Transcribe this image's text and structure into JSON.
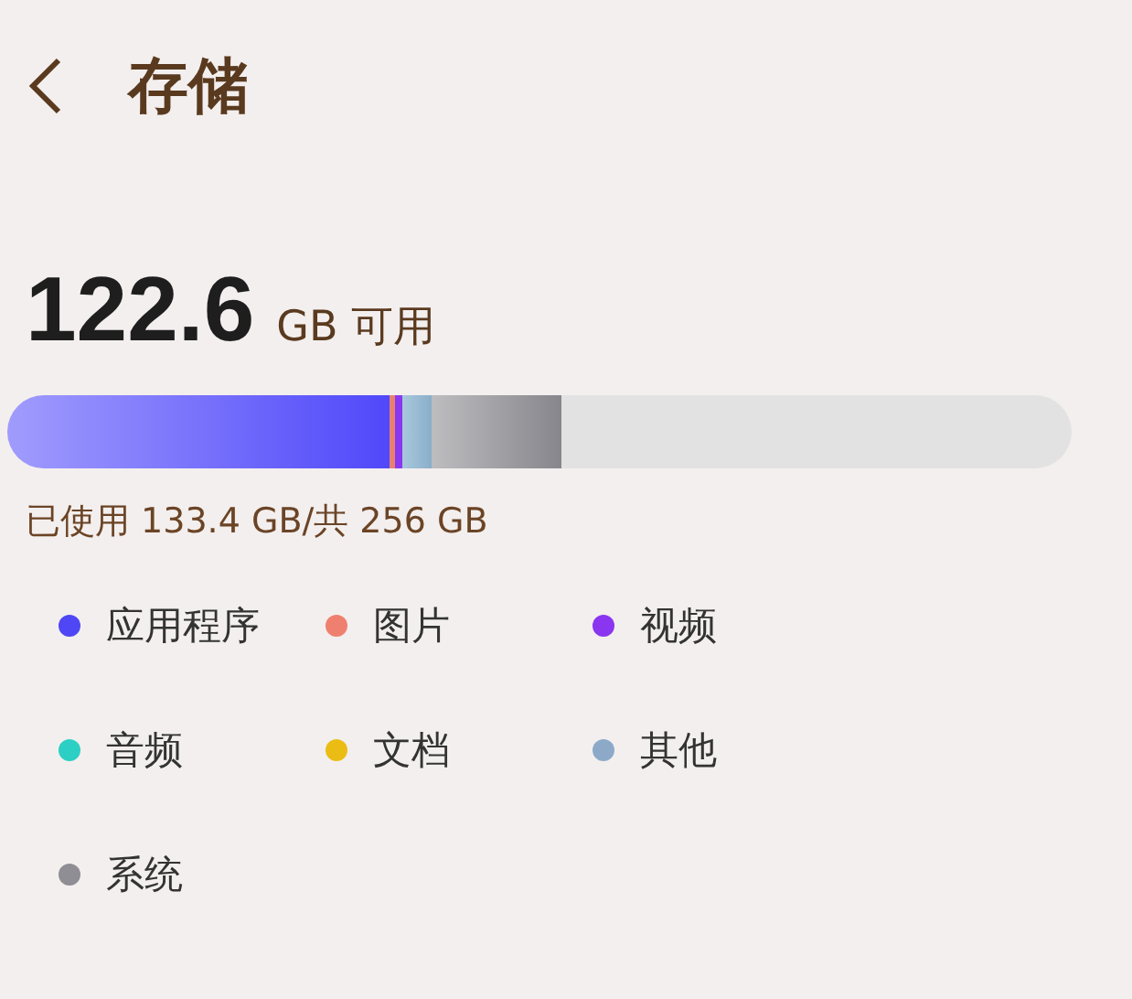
{
  "header": {
    "title": "存储"
  },
  "summary": {
    "amount": "122.6",
    "unit": "GB 可用"
  },
  "used_text": "已使用 133.4 GB/共 256 GB",
  "legend": [
    {
      "label": "应用程序",
      "color": "#4f47f5"
    },
    {
      "label": "图片",
      "color": "#ef8070"
    },
    {
      "label": "视频",
      "color": "#8a35ef"
    },
    {
      "label": "音频",
      "color": "#2ccfc4"
    },
    {
      "label": "文档",
      "color": "#ebbd14"
    },
    {
      "label": "其他",
      "color": "#8caac8"
    },
    {
      "label": "系统",
      "color": "#8f8e94"
    }
  ]
}
